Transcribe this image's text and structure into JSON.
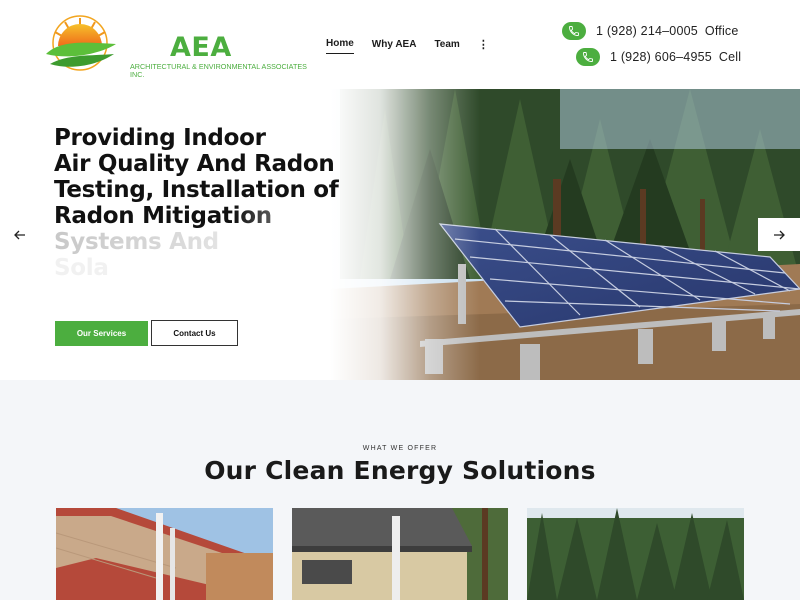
{
  "brand": {
    "abbr": "AEA",
    "full_name": "ARCHITECTURAL & ENVIRONMENTAL ASSOCIATES INC.",
    "color": "#4cae3f"
  },
  "nav": {
    "items": [
      {
        "label": "Home",
        "active": true
      },
      {
        "label": "Why AEA",
        "active": false
      },
      {
        "label": "Team",
        "active": false
      }
    ],
    "more_label": "⋮"
  },
  "contact": {
    "phones": [
      {
        "number": "1 (928) 214–0005",
        "label": "Office",
        "icon": "phone-icon"
      },
      {
        "number": "1 (928) 606–4955",
        "label": "Cell",
        "icon": "phone-icon"
      }
    ]
  },
  "hero": {
    "title_lines": [
      "Providing Indoor",
      "Air Quality And Radon",
      "Testing, Installation of",
      "Radon Mitigation",
      "Systems And",
      "Sola"
    ],
    "primary_button": "Our Services",
    "secondary_button": "Contact Us",
    "prev_icon": "arrow-left-icon",
    "next_icon": "arrow-right-icon",
    "image": "solar-panel-array-in-pine-forest"
  },
  "offer": {
    "eyebrow": "WHAT WE OFFER",
    "title": "Our Clean Energy Solutions",
    "cards": [
      {
        "image": "house-wall-with-radon-pipe"
      },
      {
        "image": "house-with-radon-vent-pipe"
      },
      {
        "image": "pine-forest-landscape"
      }
    ]
  },
  "colors": {
    "accent": "#4cae3f",
    "text": "#1c1c1c",
    "section_bg": "#f4f6f9"
  }
}
